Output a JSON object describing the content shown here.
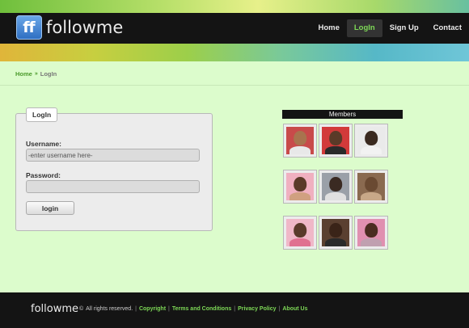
{
  "header": {
    "logo_badge": "ff",
    "logo_text": "followme",
    "nav": [
      {
        "label": "Home"
      },
      {
        "label": "LogIn",
        "active": true
      },
      {
        "label": "Sign Up"
      },
      {
        "label": "Contact"
      }
    ]
  },
  "breadcrumb": {
    "home": "Home",
    "separator": "»",
    "current": "LogIn"
  },
  "login": {
    "legend": "LogIn",
    "username_label": "Username:",
    "username_value": "-enter username here-",
    "password_label": "Password:",
    "password_value": "",
    "button_label": "login"
  },
  "members": {
    "title": "Members"
  },
  "footer": {
    "logo_text": "followme",
    "copyright_symbol": "©",
    "rights": "All rights reserved.",
    "links": [
      "Copyright",
      "Terms and Conditions",
      "Privacy Policy",
      "About Us"
    ],
    "separator": "|"
  },
  "colors": {
    "accent_green": "#7ed957",
    "header_bg": "#141414",
    "page_bg": "#dcfccc"
  }
}
